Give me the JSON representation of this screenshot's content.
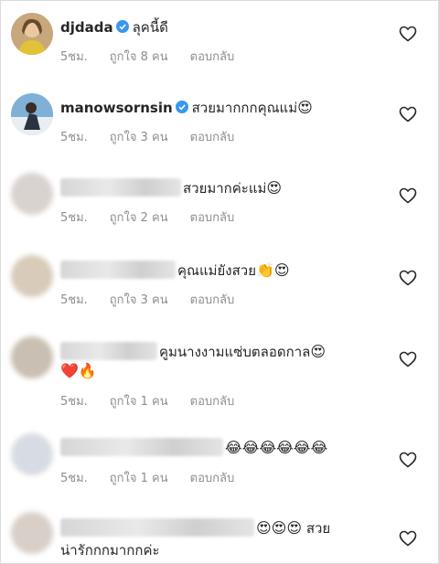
{
  "comments": [
    {
      "username": "djdada",
      "verified": true,
      "text": "ลุคนี้ดี",
      "emoji": "",
      "emoji2": "",
      "time": "5ชม.",
      "likes": "ถูกใจ 8 คน",
      "reply": "ตอบกลับ"
    },
    {
      "username": "manowsornsin",
      "verified": true,
      "text": "สวยมากกกคุณแม่",
      "emoji": "😍",
      "emoji2": "",
      "time": "5ชม.",
      "likes": "ถูกใจ 3 คน",
      "reply": "ตอบกลับ"
    },
    {
      "username": "",
      "verified": false,
      "text": "สวยมากค่ะแม่",
      "emoji": "😍",
      "emoji2": "",
      "time": "5ชม.",
      "likes": "ถูกใจ 2 คน",
      "reply": "ตอบกลับ"
    },
    {
      "username": "",
      "verified": false,
      "text": "คุณแม่ยังสวย",
      "emoji": "👏😍",
      "emoji2": "",
      "time": "5ชม.",
      "likes": "ถูกใจ 3 คน",
      "reply": "ตอบกลับ"
    },
    {
      "username": "",
      "verified": false,
      "text": "คูมนางงามแซ่บตลอดกาล",
      "emoji": "😍",
      "emoji2": "❤️🔥",
      "time": "5ชม.",
      "likes": "ถูกใจ 1 คน",
      "reply": "ตอบกลับ"
    },
    {
      "username": "",
      "verified": false,
      "text": "",
      "emoji": "😂😂😂😂😂😂",
      "emoji2": "",
      "time": "5ชม.",
      "likes": "ถูกใจ 1 คน",
      "reply": "ตอบกลับ"
    },
    {
      "username": "",
      "verified": false,
      "text": "สวย",
      "emoji": "😍😍😍",
      "emoji2": "",
      "text2": "น่ารักกกมากกค่ะ",
      "time": "",
      "likes": "",
      "reply": ""
    }
  ],
  "colors": {
    "verified": "#3897f0",
    "meta": "#8e8e8e",
    "text": "#262626"
  },
  "icons": {
    "like": "heart-outline-icon",
    "verified": "verified-badge-icon"
  }
}
